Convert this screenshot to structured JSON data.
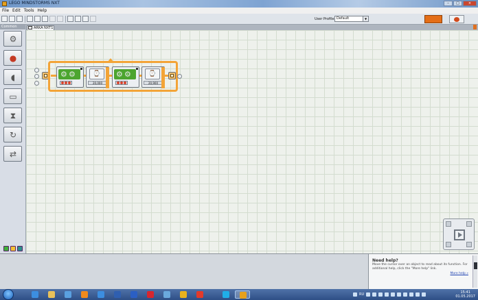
{
  "window": {
    "title": "LEGO MINDSTORMS NXT"
  },
  "menu": [
    "File",
    "Edit",
    "Tools",
    "Help"
  ],
  "toolbar": {
    "profile_label": "User Profile:",
    "profile_value": "Default"
  },
  "palette": {
    "tab_label": "Common",
    "items": [
      "move-block",
      "record-play-block",
      "sound-block",
      "display-block",
      "wait-block",
      "loop-block",
      "switch-block"
    ]
  },
  "program": {
    "tab_label": "ARKA NXT1",
    "blocks": [
      {
        "type": "move"
      },
      {
        "type": "wait",
        "value": "20,000"
      },
      {
        "type": "move"
      },
      {
        "type": "wait",
        "value": "20,900"
      }
    ]
  },
  "help": {
    "heading": "Need help?",
    "body": "Move the cursor over an object to read about its function. For additional help, click the \"More help\" link.",
    "more_link": "More help »"
  },
  "taskbar": {
    "tray_lang": "RU",
    "time": "15:41",
    "date": "01.05.2017"
  },
  "colors": {
    "sequence_beam": "#f3a437",
    "motor_block": "#4ca52f",
    "brick_button": "#e46e17"
  }
}
